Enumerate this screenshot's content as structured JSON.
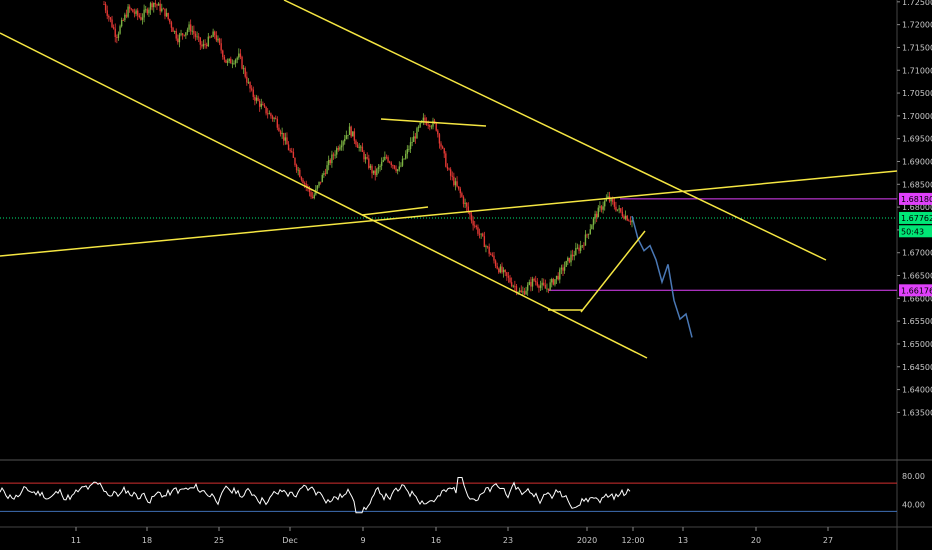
{
  "chart_data": {
    "type": "candlestick",
    "symbol_hint": "",
    "price_axis": {
      "ylim": [
        1.625,
        1.7254
      ],
      "ticks": [
        "1.72500",
        "1.72000",
        "1.71500",
        "1.71000",
        "1.70500",
        "1.70000",
        "1.69500",
        "1.69000",
        "1.68500",
        "1.68000",
        "1.67500",
        "1.67000",
        "1.66500",
        "1.66000",
        "1.65500",
        "1.65000",
        "1.64500",
        "1.64000",
        "1.63500"
      ],
      "tick_values": [
        1.725,
        1.72,
        1.715,
        1.71,
        1.705,
        1.7,
        1.695,
        1.69,
        1.685,
        1.68,
        1.675,
        1.67,
        1.665,
        1.66,
        1.655,
        1.65,
        1.645,
        1.64,
        1.635
      ]
    },
    "time_axis": {
      "labels": [
        "11",
        "18",
        "25",
        "Dec",
        "9",
        "16",
        "23",
        "2020",
        "12:00",
        "13",
        "20",
        "27"
      ]
    },
    "badges": [
      {
        "text": "1.68180",
        "value": 1.6818,
        "color": "#e040fb"
      },
      {
        "text": "1.67762",
        "value": 1.67762,
        "color": "#00e676"
      },
      {
        "text": "50:43",
        "value": 1.6747,
        "color": "#00e676"
      },
      {
        "text": "1.66176",
        "value": 1.66176,
        "color": "#e040fb"
      }
    ],
    "horizontal_levels": [
      {
        "name": "resistance",
        "value": 1.6818,
        "color": "#e040fb"
      },
      {
        "name": "current",
        "value": 1.67762,
        "color": "#00e676",
        "style": "dotted"
      },
      {
        "name": "support",
        "value": 1.66176,
        "color": "#e040fb"
      }
    ],
    "price_path": {
      "description_values": [
        1.7245,
        1.7175,
        1.7235,
        1.7215,
        1.725,
        1.7225,
        1.717,
        1.7195,
        1.715,
        1.718,
        1.7115,
        1.713,
        1.705,
        1.7015,
        1.699,
        1.693,
        1.687,
        1.682,
        1.688,
        1.693,
        1.697,
        1.692,
        1.687,
        1.691,
        1.688,
        1.694,
        1.699,
        1.698,
        1.688,
        1.683,
        1.677,
        1.672,
        1.667,
        1.664,
        1.661,
        1.664,
        1.662,
        1.665,
        1.669,
        1.672,
        1.678,
        1.682,
        1.679,
        1.677
      ]
    },
    "projection": {
      "color": "#4a78b5",
      "values": [
        1.6776,
        1.6735,
        1.67,
        1.672,
        1.668,
        1.664,
        1.667,
        1.66,
        1.655,
        1.657,
        1.651
      ]
    },
    "oscillator": {
      "ticks": [
        "80.00",
        "40.00"
      ],
      "tick_values": [
        80,
        40
      ],
      "ylim": [
        15,
        100
      ],
      "upper_level": 70,
      "lower_level": 30,
      "upper_color": "#d32f2f",
      "lower_color": "#3f6fb5"
    }
  }
}
